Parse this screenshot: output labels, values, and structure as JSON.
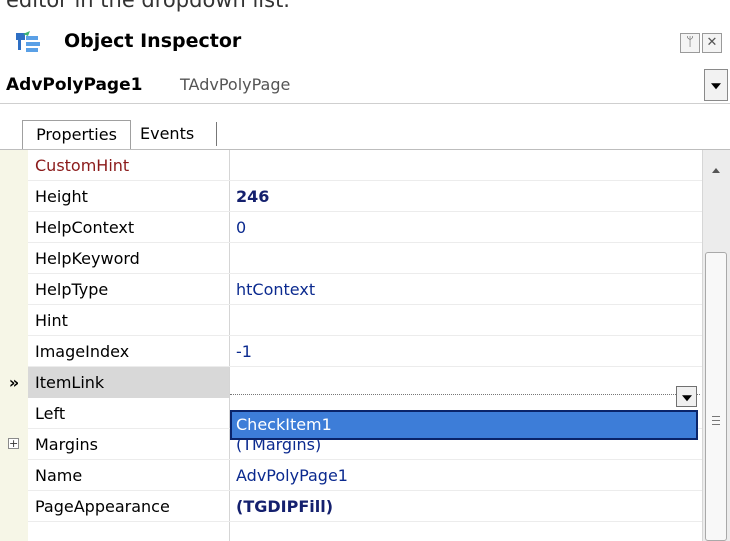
{
  "caption": "editor in the dropdown list.",
  "window": {
    "title": "Object Inspector",
    "icons": [
      "object-inspector-icon",
      "pin-icon",
      "close-icon"
    ]
  },
  "selector": {
    "name": "AdvPolyPage1",
    "type": "TAdvPolyPage"
  },
  "tabs": [
    {
      "label": "Properties",
      "active": true
    },
    {
      "label": "Events",
      "active": false
    }
  ],
  "rows": [
    {
      "name": "CustomHint",
      "value": ""
    },
    {
      "name": "Height",
      "value": "246"
    },
    {
      "name": "HelpContext",
      "value": "0"
    },
    {
      "name": "HelpKeyword",
      "value": ""
    },
    {
      "name": "HelpType",
      "value": "htContext"
    },
    {
      "name": "Hint",
      "value": ""
    },
    {
      "name": "ImageIndex",
      "value": "-1"
    },
    {
      "name": "ItemLink",
      "value": "",
      "marker": "»"
    },
    {
      "name": "Left",
      "value": ""
    },
    {
      "name": "Margins",
      "value": "(TMargins)"
    },
    {
      "name": "Name",
      "value": "AdvPolyPage1"
    },
    {
      "name": "PageAppearance",
      "value": "(TGDIPFill)"
    }
  ],
  "dropdown": {
    "options": [
      "CheckItem1"
    ],
    "highlighted": "CheckItem1"
  },
  "colors": {
    "accent": "#3d7dd8",
    "gutter": "#f6f6e7",
    "modified_value": "#14206e",
    "default_value": "#0b2a8f"
  }
}
